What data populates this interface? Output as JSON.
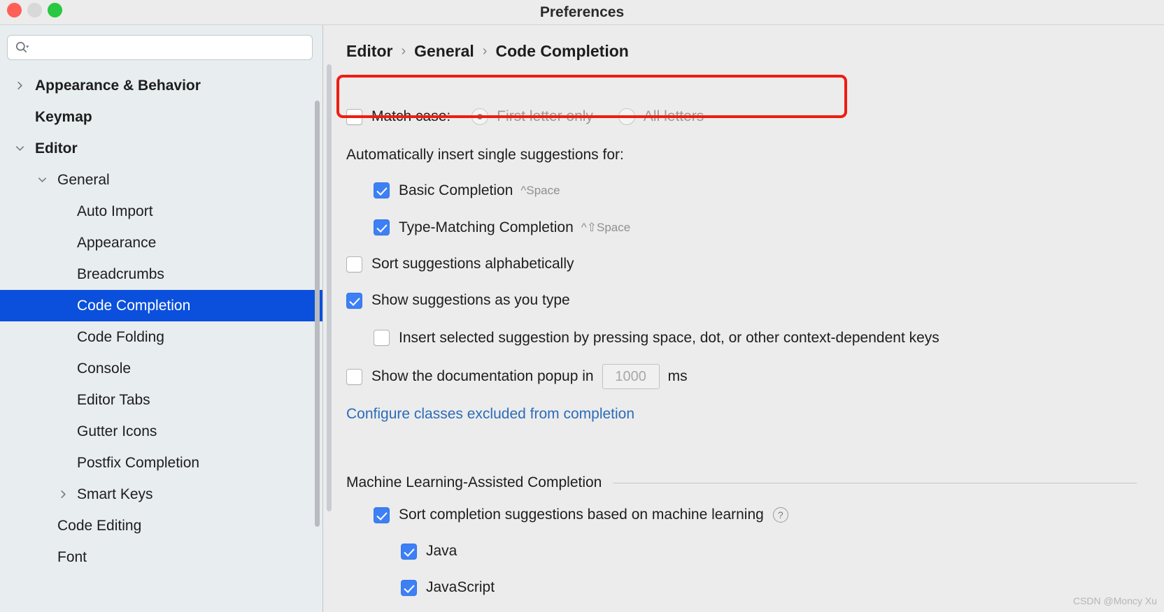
{
  "window": {
    "title": "Preferences"
  },
  "traffic_lights": {
    "close": "close-window",
    "minimize": "minimize-window",
    "zoom": "zoom-window",
    "colors": {
      "close": "#ff5f57",
      "minimize": "#d8d8d8",
      "zoom": "#28c840"
    }
  },
  "sidebar": {
    "search": {
      "value": "",
      "placeholder": "",
      "icon": "search-icon"
    },
    "accent_selected": "#0a50dc",
    "items": [
      {
        "label": "Appearance & Behavior",
        "level": 0,
        "bold": true,
        "twisty": "collapsed",
        "selected": false
      },
      {
        "label": "Keymap",
        "level": 0,
        "bold": true,
        "twisty": "none",
        "selected": false
      },
      {
        "label": "Editor",
        "level": 0,
        "bold": true,
        "twisty": "expanded",
        "selected": false
      },
      {
        "label": "General",
        "level": 1,
        "bold": false,
        "twisty": "expanded",
        "selected": false
      },
      {
        "label": "Auto Import",
        "level": 2,
        "bold": false,
        "twisty": "none",
        "selected": false
      },
      {
        "label": "Appearance",
        "level": 2,
        "bold": false,
        "twisty": "none",
        "selected": false
      },
      {
        "label": "Breadcrumbs",
        "level": 2,
        "bold": false,
        "twisty": "none",
        "selected": false
      },
      {
        "label": "Code Completion",
        "level": 2,
        "bold": false,
        "twisty": "none",
        "selected": true
      },
      {
        "label": "Code Folding",
        "level": 2,
        "bold": false,
        "twisty": "none",
        "selected": false
      },
      {
        "label": "Console",
        "level": 2,
        "bold": false,
        "twisty": "none",
        "selected": false
      },
      {
        "label": "Editor Tabs",
        "level": 2,
        "bold": false,
        "twisty": "none",
        "selected": false
      },
      {
        "label": "Gutter Icons",
        "level": 2,
        "bold": false,
        "twisty": "none",
        "selected": false
      },
      {
        "label": "Postfix Completion",
        "level": 2,
        "bold": false,
        "twisty": "none",
        "selected": false
      },
      {
        "label": "Smart Keys",
        "level": 2,
        "bold": false,
        "twisty": "collapsed",
        "selected": false
      },
      {
        "label": "Code Editing",
        "level": 1,
        "bold": false,
        "twisty": "none",
        "selected": false
      },
      {
        "label": "Font",
        "level": 1,
        "bold": false,
        "twisty": "none",
        "selected": false
      }
    ]
  },
  "breadcrumb": {
    "parts": [
      "Editor",
      "General",
      "Code Completion"
    ],
    "separator": "›"
  },
  "settings": {
    "match_case": {
      "label": "Match case:",
      "checked": false,
      "options": [
        {
          "label": "First letter only",
          "selected": true,
          "disabled": true
        },
        {
          "label": "All letters",
          "selected": false,
          "disabled": true
        }
      ]
    },
    "auto_insert_header": "Automatically insert single suggestions for:",
    "auto_insert_items": [
      {
        "label": "Basic Completion",
        "checked": true,
        "shortcut": "^Space"
      },
      {
        "label": "Type-Matching Completion",
        "checked": true,
        "shortcut": "^⇧Space"
      }
    ],
    "sort_alphabetically": {
      "label": "Sort suggestions alphabetically",
      "checked": false
    },
    "show_as_you_type": {
      "label": "Show suggestions as you type",
      "checked": true
    },
    "insert_on_keys": {
      "label": "Insert selected suggestion by pressing space, dot, or other context-dependent keys",
      "checked": false
    },
    "doc_popup": {
      "label_before": "Show the documentation popup in",
      "checked": false,
      "delay_value": "1000",
      "unit": "ms",
      "disabled": true
    },
    "excluded_link": "Configure classes excluded from completion",
    "ml_section": {
      "title": "Machine Learning-Assisted Completion",
      "sort_by_ml": {
        "label": "Sort completion suggestions based on machine learning",
        "checked": true,
        "help": "?"
      },
      "languages": [
        {
          "label": "Java",
          "checked": true
        },
        {
          "label": "JavaScript",
          "checked": true
        }
      ]
    }
  },
  "annotation": {
    "color": "#ef1d11",
    "target": "match-case-row"
  },
  "watermark": "CSDN @Moncy Xu"
}
